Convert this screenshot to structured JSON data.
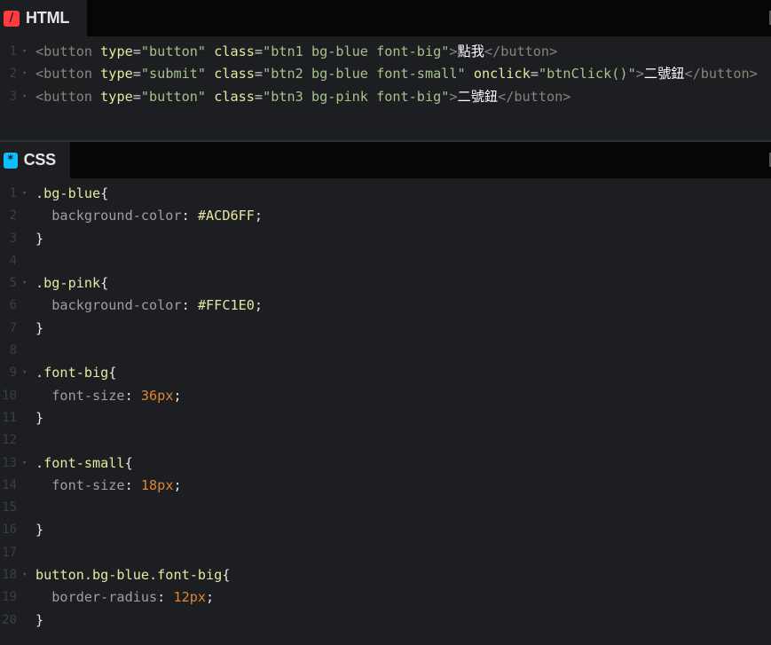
{
  "html_panel": {
    "title": "HTML",
    "lines": [
      {
        "num": "1",
        "fold": "▾",
        "tokens": [
          {
            "t": "<button ",
            "c": "tag"
          },
          {
            "t": "type",
            "c": "attr"
          },
          {
            "t": "=",
            "c": "eq"
          },
          {
            "t": "\"button\"",
            "c": "str"
          },
          {
            "t": " ",
            "c": "tag"
          },
          {
            "t": "class",
            "c": "attr"
          },
          {
            "t": "=",
            "c": "eq"
          },
          {
            "t": "\"btn1 bg-blue font-big\"",
            "c": "str"
          },
          {
            "t": ">",
            "c": "tag"
          },
          {
            "t": "點我",
            "c": "txt"
          },
          {
            "t": "</button>",
            "c": "tag"
          }
        ]
      },
      {
        "num": "2",
        "fold": "▾",
        "tokens": [
          {
            "t": "<button ",
            "c": "tag"
          },
          {
            "t": "type",
            "c": "attr"
          },
          {
            "t": "=",
            "c": "eq"
          },
          {
            "t": "\"submit\"",
            "c": "str"
          },
          {
            "t": " ",
            "c": "tag"
          },
          {
            "t": "class",
            "c": "attr"
          },
          {
            "t": "=",
            "c": "eq"
          },
          {
            "t": "\"btn2 bg-blue font-small\"",
            "c": "str"
          },
          {
            "t": " ",
            "c": "tag"
          },
          {
            "t": "onclick",
            "c": "attr"
          },
          {
            "t": "=",
            "c": "eq"
          },
          {
            "t": "\"btnClick()\"",
            "c": "str"
          },
          {
            "t": ">",
            "c": "tag"
          },
          {
            "t": "二號鈕",
            "c": "txt"
          },
          {
            "t": "</button>",
            "c": "tag"
          }
        ]
      },
      {
        "num": "3",
        "fold": "▾",
        "tokens": [
          {
            "t": "<button ",
            "c": "tag"
          },
          {
            "t": "type",
            "c": "attr"
          },
          {
            "t": "=",
            "c": "eq"
          },
          {
            "t": "\"button\"",
            "c": "str"
          },
          {
            "t": " ",
            "c": "tag"
          },
          {
            "t": "class",
            "c": "attr"
          },
          {
            "t": "=",
            "c": "eq"
          },
          {
            "t": "\"btn3 bg-pink font-big\"",
            "c": "str"
          },
          {
            "t": ">",
            "c": "tag"
          },
          {
            "t": "二號鈕",
            "c": "txt"
          },
          {
            "t": "</button>",
            "c": "tag"
          }
        ]
      }
    ]
  },
  "css_panel": {
    "title": "CSS",
    "lines": [
      {
        "num": "1",
        "fold": "▾",
        "tokens": [
          {
            "t": ".bg-blue",
            "c": "sel"
          },
          {
            "t": "{",
            "c": "brace"
          }
        ]
      },
      {
        "num": "2",
        "fold": "",
        "tokens": [
          {
            "t": "  background-color",
            "c": "prop"
          },
          {
            "t": ": ",
            "c": "colon"
          },
          {
            "t": "#ACD6FF",
            "c": "val"
          },
          {
            "t": ";",
            "c": "colon"
          }
        ]
      },
      {
        "num": "3",
        "fold": "",
        "tokens": [
          {
            "t": "}",
            "c": "brace"
          }
        ]
      },
      {
        "num": "4",
        "fold": "",
        "tokens": []
      },
      {
        "num": "5",
        "fold": "▾",
        "tokens": [
          {
            "t": ".bg-pink",
            "c": "sel"
          },
          {
            "t": "{",
            "c": "brace"
          }
        ]
      },
      {
        "num": "6",
        "fold": "",
        "tokens": [
          {
            "t": "  background-color",
            "c": "prop"
          },
          {
            "t": ": ",
            "c": "colon"
          },
          {
            "t": "#FFC1E0",
            "c": "val"
          },
          {
            "t": ";",
            "c": "colon"
          }
        ]
      },
      {
        "num": "7",
        "fold": "",
        "tokens": [
          {
            "t": "}",
            "c": "brace"
          }
        ]
      },
      {
        "num": "8",
        "fold": "",
        "tokens": []
      },
      {
        "num": "9",
        "fold": "▾",
        "tokens": [
          {
            "t": ".font-big",
            "c": "sel"
          },
          {
            "t": "{",
            "c": "brace"
          }
        ]
      },
      {
        "num": "10",
        "fold": "",
        "tokens": [
          {
            "t": "  font-size",
            "c": "prop"
          },
          {
            "t": ": ",
            "c": "colon"
          },
          {
            "t": "36px",
            "c": "num"
          },
          {
            "t": ";",
            "c": "colon"
          }
        ]
      },
      {
        "num": "11",
        "fold": "",
        "tokens": [
          {
            "t": "}",
            "c": "brace"
          }
        ]
      },
      {
        "num": "12",
        "fold": "",
        "tokens": []
      },
      {
        "num": "13",
        "fold": "▾",
        "tokens": [
          {
            "t": ".font-small",
            "c": "sel"
          },
          {
            "t": "{",
            "c": "brace"
          }
        ]
      },
      {
        "num": "14",
        "fold": "",
        "tokens": [
          {
            "t": "  font-size",
            "c": "prop"
          },
          {
            "t": ": ",
            "c": "colon"
          },
          {
            "t": "18px",
            "c": "num"
          },
          {
            "t": ";",
            "c": "colon"
          }
        ]
      },
      {
        "num": "15",
        "fold": "",
        "tokens": []
      },
      {
        "num": "16",
        "fold": "",
        "tokens": [
          {
            "t": "}",
            "c": "brace"
          }
        ]
      },
      {
        "num": "17",
        "fold": "",
        "tokens": []
      },
      {
        "num": "18",
        "fold": "▾",
        "tokens": [
          {
            "t": "button.bg-blue.font-big",
            "c": "sel"
          },
          {
            "t": "{",
            "c": "brace"
          }
        ]
      },
      {
        "num": "19",
        "fold": "",
        "tokens": [
          {
            "t": "  border-radius",
            "c": "prop"
          },
          {
            "t": ": ",
            "c": "colon"
          },
          {
            "t": "12px",
            "c": "num"
          },
          {
            "t": ";",
            "c": "colon"
          }
        ]
      },
      {
        "num": "20",
        "fold": "",
        "tokens": [
          {
            "t": "}",
            "c": "brace"
          }
        ]
      }
    ]
  }
}
